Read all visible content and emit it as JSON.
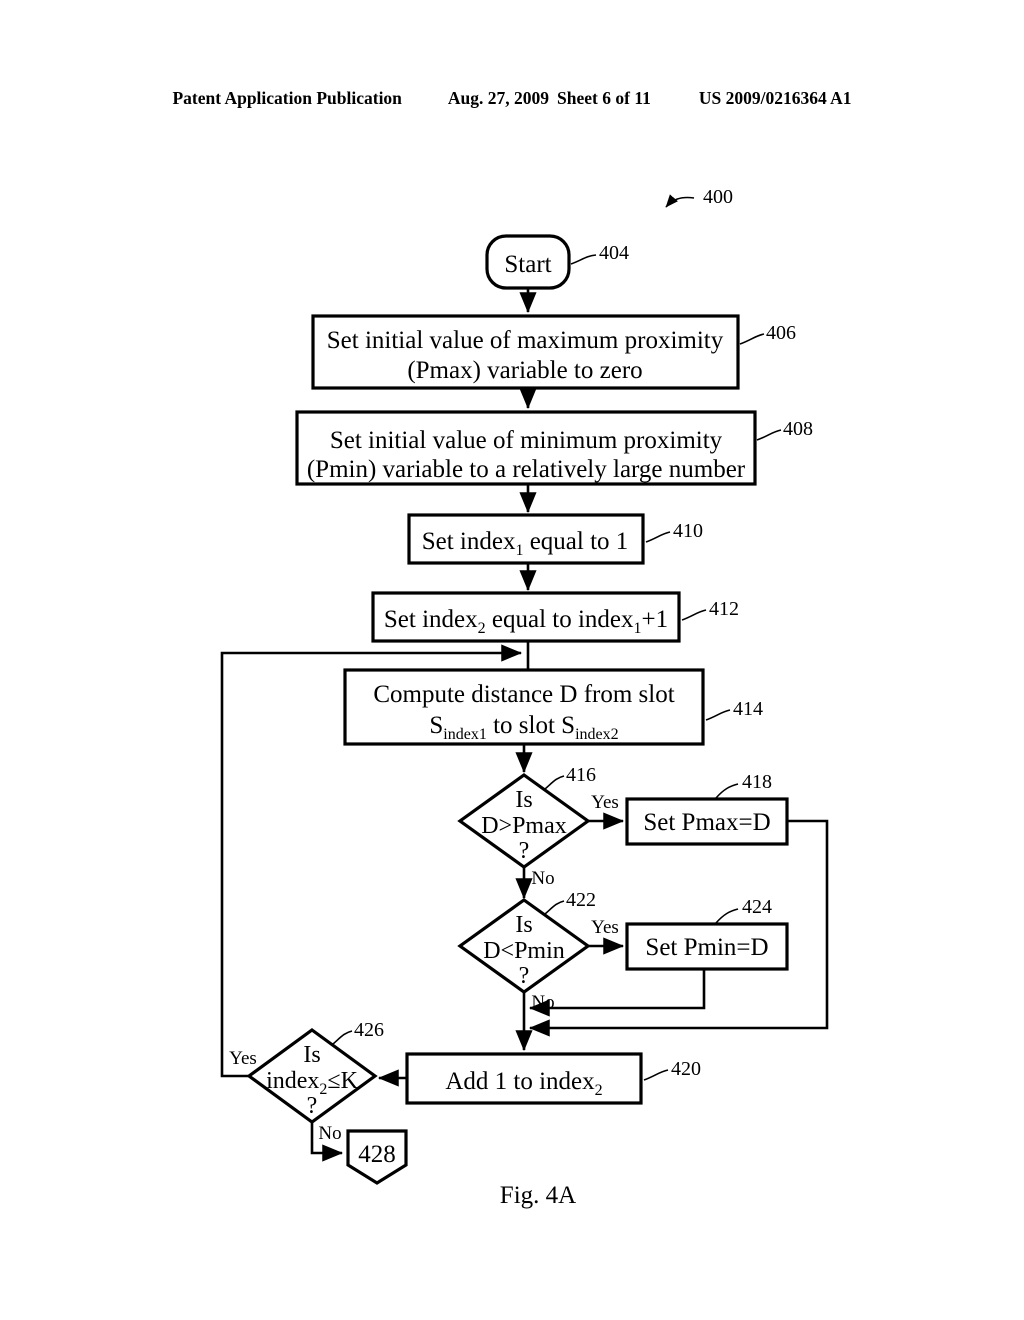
{
  "header": {
    "publication": "Patent Application Publication",
    "date": "Aug. 27, 2009",
    "sheet": "Sheet 6 of 11",
    "patent_number": "US 2009/0216364 A1"
  },
  "figure": {
    "caption": "Fig. 4A",
    "figure_ref": "400"
  },
  "nodes": {
    "start": {
      "ref": "404",
      "label": "Start"
    },
    "pmax_init": {
      "ref": "406",
      "line1": "Set initial value of maximum proximity",
      "line2": "(Pmax) variable to zero"
    },
    "pmin_init": {
      "ref": "408",
      "line1": "Set initial value of minimum proximity",
      "line2": "(Pmin) variable to a relatively large number"
    },
    "set_index1": {
      "ref": "410",
      "pre": "Set index",
      "sub": "1",
      "post": " equal to 1"
    },
    "set_index2": {
      "ref": "412",
      "pre": "Set index",
      "sub": "2",
      "mid": " equal to index",
      "sub2": "1",
      "post": "+1"
    },
    "compute_distance": {
      "ref": "414",
      "line1": "Compute distance D from slot",
      "line2_a": "S",
      "line2_sub_a": "index1",
      "line2_b": " to slot S",
      "line2_sub_b": "index2"
    },
    "decision_dmax": {
      "ref": "416",
      "line1": "Is",
      "line2": "D>Pmax",
      "line3": "?",
      "yes": "Yes",
      "no": "No"
    },
    "set_pmax": {
      "ref": "418",
      "label": "Set Pmax=D"
    },
    "decision_dmin": {
      "ref": "422",
      "line1": "Is",
      "line2": "D<Pmin",
      "line3": "?",
      "yes": "Yes",
      "no": "No"
    },
    "set_pmin": {
      "ref": "424",
      "label": "Set Pmin=D"
    },
    "add_index2": {
      "ref": "420",
      "pre": "Add 1 to index",
      "sub": "2"
    },
    "decision_index2k": {
      "ref": "426",
      "line1": "Is",
      "line2_pre": "index",
      "line2_sub": "2",
      "line2_post": "≤K",
      "line3": "?",
      "yes": "Yes",
      "no": "No"
    },
    "connector_end": {
      "ref": "428",
      "label": "428"
    }
  },
  "colors": {
    "ink": "#000000",
    "paper": "#ffffff"
  }
}
